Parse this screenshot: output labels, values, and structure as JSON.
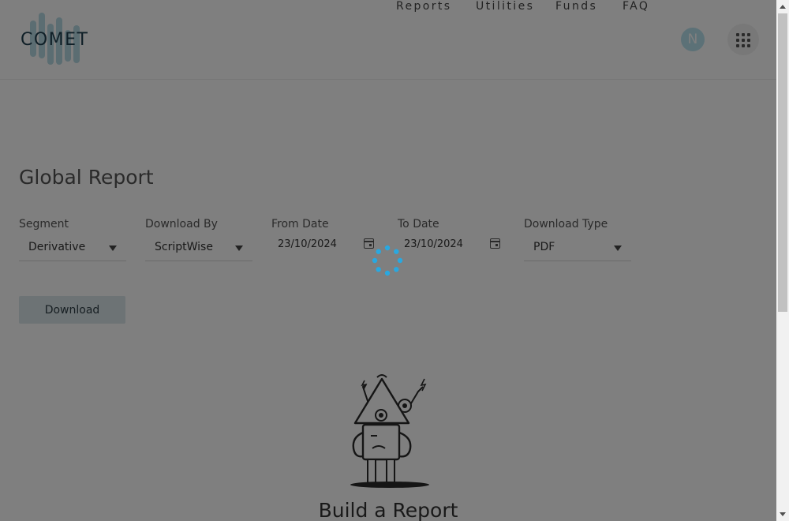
{
  "brand": {
    "name": "COMET",
    "color": "#1f3f4f",
    "accent": "#b7dbe4"
  },
  "nav": {
    "items": [
      "Reports",
      "Utilities",
      "Funds",
      "FAQ"
    ]
  },
  "user": {
    "initial": "N"
  },
  "icons": {
    "apps": "grid-apps-icon",
    "calendar": "calendar-icon",
    "dropdown": "caret-down-icon",
    "loader": "spinner-icon"
  },
  "report": {
    "title": "Global Report",
    "segment": {
      "label": "Segment",
      "value": "Derivative"
    },
    "download_by": {
      "label": "Download By",
      "value": "ScriptWise"
    },
    "from_date": {
      "label": "From Date",
      "value": "23/10/2024"
    },
    "to_date": {
      "label": "To Date",
      "value": "23/10/2024"
    },
    "download_type": {
      "label": "Download Type",
      "value": "PDF"
    },
    "download_label": "Download"
  },
  "empty_state": {
    "title": "Build a Report"
  },
  "overlay": {
    "visible": true,
    "spinner_color": "#29a8e0"
  }
}
